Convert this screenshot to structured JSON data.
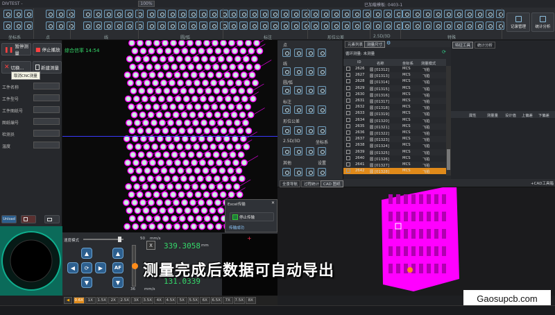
{
  "window": {
    "title": "DIVTEST -",
    "menu_item": "已加载模板: 0403-1",
    "zoom": "100%"
  },
  "toolbar": {
    "groups": [
      "坐标系",
      "点",
      "线",
      "圆/弧",
      "标注",
      "形位公差",
      "2.5D/3D",
      "特殊"
    ],
    "right_buttons": [
      "记录管理",
      "统计分析"
    ]
  },
  "left": {
    "stop_measure": "暂停测量",
    "stop_play": "停止播放",
    "toggle": "切换...",
    "new_measure": "新建测量",
    "tooltip": "取消CNC测量",
    "fields": [
      "工件名称",
      "工件型号",
      "工件图纸号",
      "图纸编号",
      "检测员",
      "温度"
    ],
    "unload_btn": "Unload"
  },
  "viewport": {
    "match_rate": "综合信率 14:54"
  },
  "control": {
    "speed_mode": "速度模式",
    "speed_value": "50",
    "speed_unit": "mm/s",
    "speed_value2": "36",
    "speed_unit2": "mm/s",
    "axis_x": "X",
    "x_value": "339.3058",
    "x_unit": "mm",
    "y_value": "131.0339",
    "af_label": "AF"
  },
  "speeds": [
    "0.6X",
    "1X",
    "1.5X",
    "2X",
    "2.5X",
    "3X",
    "3.5X",
    "4X",
    "4.5X",
    "5X",
    "5.5X",
    "6X",
    "6.5X",
    "7X",
    "7.5X",
    "8X"
  ],
  "popup": {
    "title": "Excel传输",
    "stop_transfer": "停止传输",
    "status": "传输成功"
  },
  "palette": {
    "sections": [
      "点",
      "线",
      "圆/弧",
      "标注",
      "形位公差",
      "2.5D/3D",
      "坐标系",
      "其他",
      "设置"
    ]
  },
  "table": {
    "tabs": [
      "元素列表",
      "测量尺寸"
    ],
    "loop_label": "循环测量: 未测量",
    "headers": [
      "ID",
      "名称",
      "坐标系",
      "测量模式"
    ],
    "rows": [
      {
        "id": "2626",
        "name": "圆 [01312]",
        "cs": "MCS",
        "mode": "飞拍"
      },
      {
        "id": "2627",
        "name": "圆 [01313]",
        "cs": "MCS",
        "mode": "飞拍"
      },
      {
        "id": "2628",
        "name": "圆 [01314]",
        "cs": "MCS",
        "mode": "飞拍"
      },
      {
        "id": "2629",
        "name": "圆 [01315]",
        "cs": "MCS",
        "mode": "飞拍"
      },
      {
        "id": "2630",
        "name": "圆 [01316]",
        "cs": "MCS",
        "mode": "飞拍"
      },
      {
        "id": "2631",
        "name": "圆 [01317]",
        "cs": "MCS",
        "mode": "飞拍"
      },
      {
        "id": "2632",
        "name": "圆 [01318]",
        "cs": "MCS",
        "mode": "飞拍"
      },
      {
        "id": "2633",
        "name": "圆 [01319]",
        "cs": "MCS",
        "mode": "飞拍"
      },
      {
        "id": "2634",
        "name": "圆 [01320]",
        "cs": "MCS",
        "mode": "飞拍"
      },
      {
        "id": "2635",
        "name": "圆 [01321]",
        "cs": "MCS",
        "mode": "飞拍"
      },
      {
        "id": "2636",
        "name": "圆 [01322]",
        "cs": "MCS",
        "mode": "飞拍"
      },
      {
        "id": "2637",
        "name": "圆 [01323]",
        "cs": "MCS",
        "mode": "飞拍"
      },
      {
        "id": "2638",
        "name": "圆 [01324]",
        "cs": "MCS",
        "mode": "飞拍"
      },
      {
        "id": "2639",
        "name": "圆 [01325]",
        "cs": "MCS",
        "mode": "飞拍"
      },
      {
        "id": "2640",
        "name": "圆 [01326]",
        "cs": "MCS",
        "mode": "飞拍"
      },
      {
        "id": "2641",
        "name": "圆 [01327]",
        "cs": "MCS",
        "mode": "飞拍"
      },
      {
        "id": "2642",
        "name": "圆 [01328]",
        "cs": "MCS",
        "mode": "飞拍"
      }
    ]
  },
  "right": {
    "tabs": [
      "特征工具",
      "统计分析"
    ],
    "headers": [
      "属性",
      "测量量",
      "设计值",
      "上偏差",
      "下偏差"
    ]
  },
  "cad": {
    "tabs": [
      "全景导航",
      "过程统计",
      "CAD 图纸"
    ],
    "right_label": "+CAD工具箱"
  },
  "caption": "测量完成后数据可自动导出",
  "watermark": "Gaosupcb.com",
  "colors": {
    "accent": "#ff5a00",
    "highlight": "#ff8c1a",
    "magenta": "#ff00ff",
    "green": "#35d86a"
  }
}
